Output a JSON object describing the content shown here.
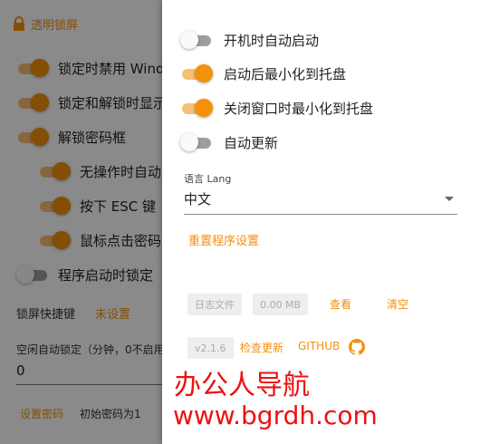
{
  "header": {
    "title": "透明锁屏",
    "icon": "lock-icon",
    "accent": "#f5900b"
  },
  "background_settings": {
    "toggles": [
      {
        "label": "锁定时禁用 Windows",
        "on": true
      },
      {
        "label": "锁定和解锁时显示",
        "on": true
      },
      {
        "label": "解锁密码框",
        "on": true
      },
      {
        "label": "无操作时自动",
        "on": true
      },
      {
        "label": "按下 ESC 键",
        "on": true
      },
      {
        "label": "鼠标点击密码",
        "on": true
      },
      {
        "label": "程序启动时锁定",
        "on": false
      }
    ],
    "shortcut": {
      "label": "锁屏快捷键",
      "value": "未设置"
    },
    "idle_lock": {
      "label": "空闲自动锁定（分钟，0不启用",
      "value": "0"
    },
    "password": {
      "set_label": "设置密码",
      "hint": "初始密码为1"
    }
  },
  "drawer": {
    "toggles": [
      {
        "label": "开机时自动启动",
        "on": false
      },
      {
        "label": "启动后最小化到托盘",
        "on": true
      },
      {
        "label": "关闭窗口时最小化到托盘",
        "on": true
      },
      {
        "label": "自动更新",
        "on": false
      }
    ],
    "language": {
      "label": "语言 Lang",
      "value": "中文"
    },
    "reset_label": "重置程序设置",
    "log": {
      "file_label": "日志文件",
      "size": "0.00 MB",
      "view": "查看",
      "clear": "清空"
    },
    "version": "v2.1.6",
    "check_update": "检查更新",
    "github": "GITHUB"
  },
  "watermark": {
    "line1": "办公人导航",
    "line2": "www.bgrdh.com",
    "color": "#ee1111"
  }
}
